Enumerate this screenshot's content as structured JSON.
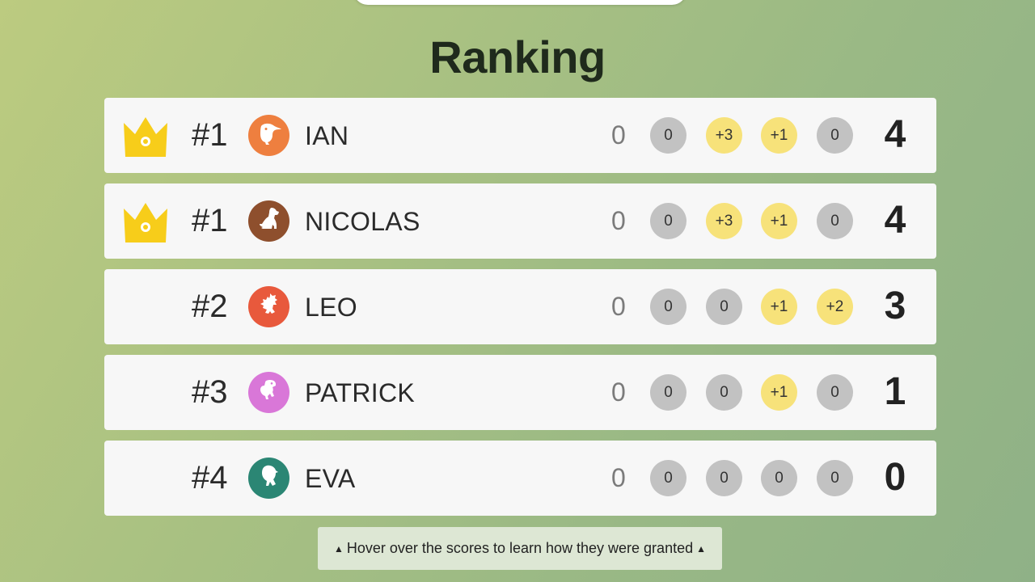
{
  "page": {
    "title": "Ranking"
  },
  "rows": [
    {
      "rank": "#1",
      "name": "IAN",
      "crown": true,
      "avatar_color": "#ee7f3f",
      "avatar_icon": "toucan-icon",
      "base": "0",
      "scores": [
        {
          "v": "0",
          "t": "zero"
        },
        {
          "v": "+3",
          "t": "pos"
        },
        {
          "v": "+1",
          "t": "pos"
        },
        {
          "v": "0",
          "t": "zero"
        }
      ],
      "total": "4"
    },
    {
      "rank": "#1",
      "name": "NICOLAS",
      "crown": true,
      "avatar_color": "#8e4f2d",
      "avatar_icon": "dog-icon",
      "base": "0",
      "scores": [
        {
          "v": "0",
          "t": "zero"
        },
        {
          "v": "+3",
          "t": "pos"
        },
        {
          "v": "+1",
          "t": "pos"
        },
        {
          "v": "0",
          "t": "zero"
        }
      ],
      "total": "4"
    },
    {
      "rank": "#2",
      "name": "LEO",
      "crown": false,
      "avatar_color": "#e8593c",
      "avatar_icon": "dragon-icon",
      "base": "0",
      "scores": [
        {
          "v": "0",
          "t": "zero"
        },
        {
          "v": "0",
          "t": "zero"
        },
        {
          "v": "+1",
          "t": "pos"
        },
        {
          "v": "+2",
          "t": "pos"
        }
      ],
      "total": "3"
    },
    {
      "rank": "#3",
      "name": "PATRICK",
      "crown": false,
      "avatar_color": "#d977d8",
      "avatar_icon": "dinosaur-icon",
      "base": "0",
      "scores": [
        {
          "v": "0",
          "t": "zero"
        },
        {
          "v": "0",
          "t": "zero"
        },
        {
          "v": "+1",
          "t": "pos"
        },
        {
          "v": "0",
          "t": "zero"
        }
      ],
      "total": "1"
    },
    {
      "rank": "#4",
      "name": "EVA",
      "crown": false,
      "avatar_color": "#2b8674",
      "avatar_icon": "parrot-icon",
      "base": "0",
      "scores": [
        {
          "v": "0",
          "t": "zero"
        },
        {
          "v": "0",
          "t": "zero"
        },
        {
          "v": "0",
          "t": "zero"
        },
        {
          "v": "0",
          "t": "zero"
        }
      ],
      "total": "0"
    }
  ],
  "hint": {
    "text": "Hover over the scores to learn how they were granted"
  },
  "colors": {
    "crown": "#f7cd1a",
    "badge_zero": "#c2c2c2",
    "badge_positive": "#f7e27a"
  }
}
